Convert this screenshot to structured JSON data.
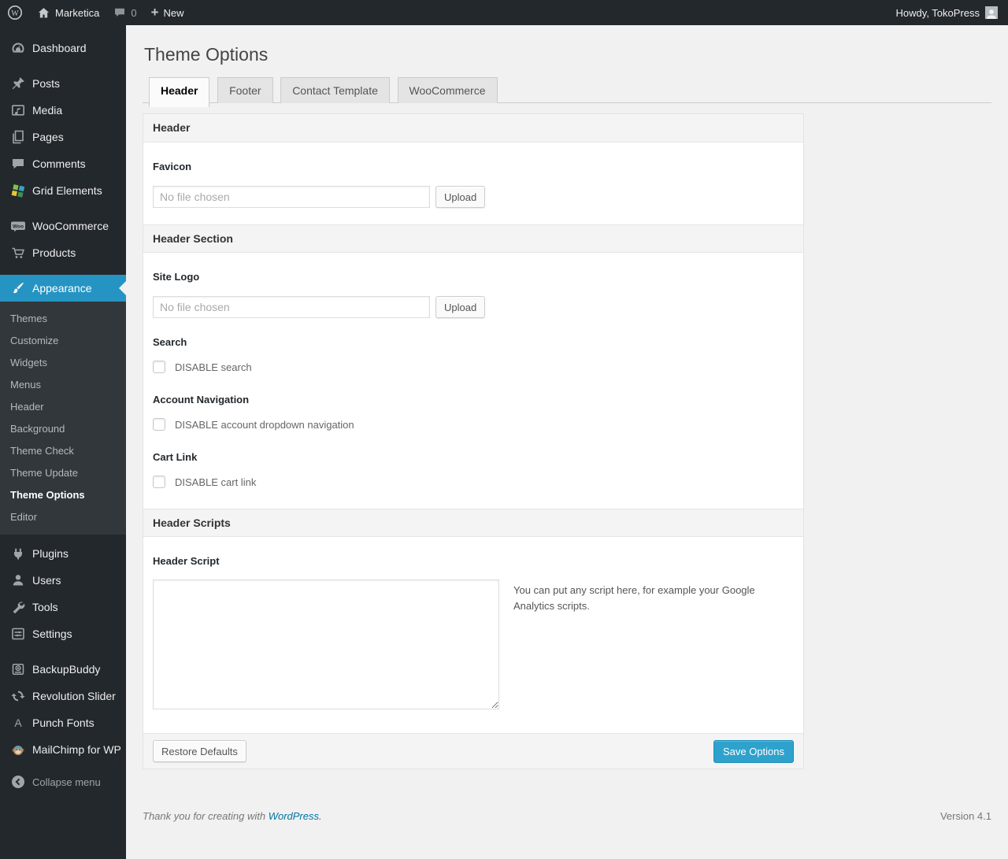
{
  "admin_bar": {
    "site_name": "Marketica",
    "comment_count": "0",
    "new_label": "New",
    "howdy": "Howdy, TokoPress"
  },
  "sidebar": {
    "items": [
      {
        "label": "Dashboard",
        "icon": "dashboard-icon"
      },
      {
        "label": "Posts",
        "icon": "pushpin-icon"
      },
      {
        "label": "Media",
        "icon": "media-icon"
      },
      {
        "label": "Pages",
        "icon": "pages-icon"
      },
      {
        "label": "Comments",
        "icon": "comments-icon"
      },
      {
        "label": "Grid Elements",
        "icon": "grid-elements-icon"
      },
      {
        "label": "WooCommerce",
        "icon": "woo-badge-icon"
      },
      {
        "label": "Products",
        "icon": "cart-icon"
      },
      {
        "label": "Appearance",
        "icon": "brush-icon"
      },
      {
        "label": "Plugins",
        "icon": "plug-icon"
      },
      {
        "label": "Users",
        "icon": "user-icon"
      },
      {
        "label": "Tools",
        "icon": "wrench-icon"
      },
      {
        "label": "Settings",
        "icon": "sliders-icon"
      },
      {
        "label": "BackupBuddy",
        "icon": "backup-icon"
      },
      {
        "label": "Revolution Slider",
        "icon": "refresh-icon"
      },
      {
        "label": "Punch Fonts",
        "icon": "letter-a-icon"
      },
      {
        "label": "MailChimp for WP",
        "icon": "monkey-icon"
      },
      {
        "label": "Collapse menu",
        "icon": "collapse-arrow-icon"
      }
    ],
    "appearance_submenu": {
      "current": "Theme Options",
      "items": [
        {
          "label": "Themes"
        },
        {
          "label": "Customize"
        },
        {
          "label": "Widgets"
        },
        {
          "label": "Menus"
        },
        {
          "label": "Header"
        },
        {
          "label": "Background"
        },
        {
          "label": "Theme Check"
        },
        {
          "label": "Theme Update"
        },
        {
          "label": "Theme Options"
        },
        {
          "label": "Editor"
        }
      ]
    }
  },
  "main": {
    "page_title": "Theme Options",
    "tabs": [
      {
        "label": "Header",
        "active": true
      },
      {
        "label": "Footer",
        "active": false
      },
      {
        "label": "Contact Template",
        "active": false
      },
      {
        "label": "WooCommerce",
        "active": false
      }
    ],
    "panel": {
      "header_section_title": "Header",
      "favicon_label": "Favicon",
      "favicon_value": "No file chosen",
      "favicon_upload_label": "Upload",
      "header_section2_title": "Header Section",
      "site_logo_label": "Site Logo",
      "site_logo_value": "No file chosen",
      "site_logo_upload_label": "Upload",
      "search_label": "Search",
      "search_checkbox_label": "DISABLE search",
      "account_nav_label": "Account Navigation",
      "account_nav_checkbox_label": "DISABLE account dropdown navigation",
      "cart_link_label": "Cart Link",
      "cart_link_checkbox_label": "DISABLE cart link",
      "header_scripts_title": "Header Scripts",
      "header_script_label": "Header Script",
      "header_script_value": "",
      "header_script_note": "You can put any script here, for example your Google Analytics scripts.",
      "restore_defaults_label": "Restore Defaults",
      "save_options_label": "Save Options"
    }
  },
  "footer": {
    "thanks_prefix": "Thank you for creating with",
    "wordpress_link": "WordPress.",
    "version": "Version 4.1"
  },
  "colors": {
    "admin_bar_bg": "#23282d",
    "sidebar_bg": "#23282d",
    "submenu_bg": "#32373c",
    "menu_highlight": "#2694c3",
    "primary_button": "#2ea2cc",
    "link_blue": "#0074a2",
    "page_bg": "#f1f1f1"
  }
}
